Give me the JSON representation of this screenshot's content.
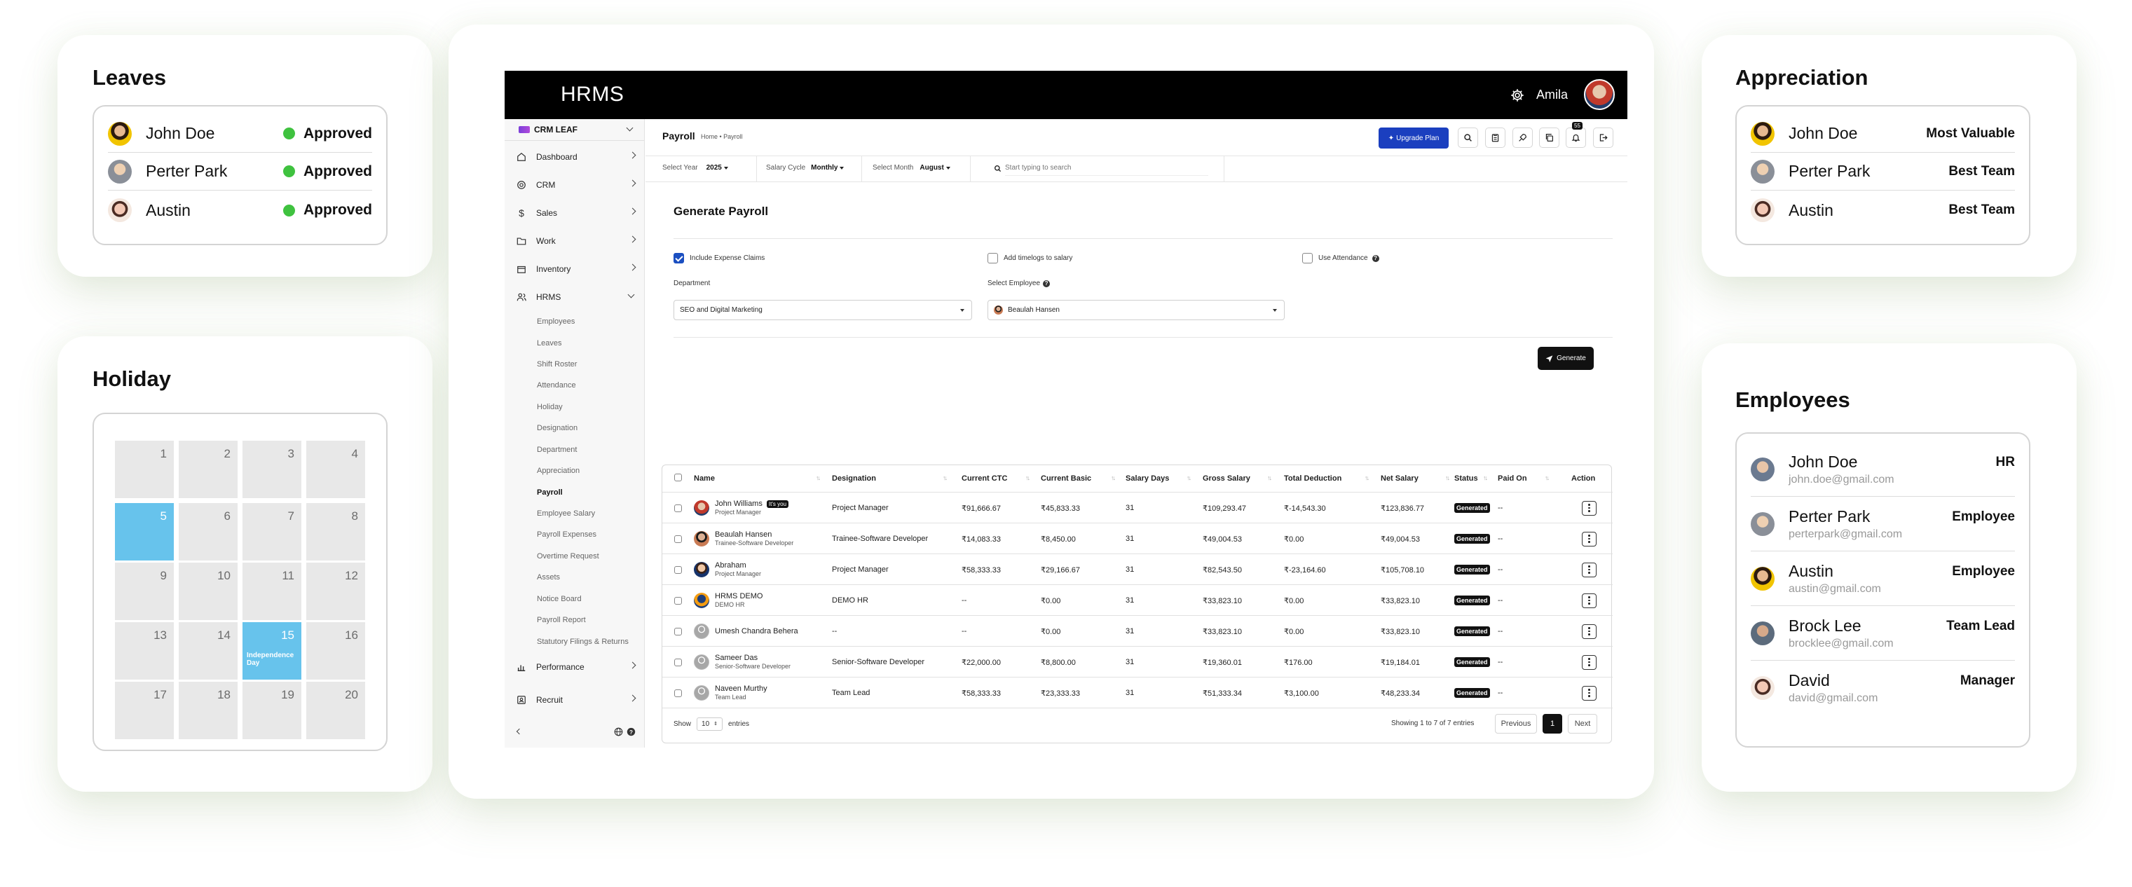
{
  "leaves": {
    "title": "Leaves",
    "items": [
      {
        "name": "John Doe",
        "status": "Approved"
      },
      {
        "name": "Perter Park",
        "status": "Approved"
      },
      {
        "name": "Austin",
        "status": "Approved"
      }
    ]
  },
  "holiday": {
    "title": "Holiday",
    "days": [
      "1",
      "2",
      "3",
      "4",
      "5",
      "6",
      "7",
      "8",
      "9",
      "10",
      "11",
      "12",
      "13",
      "14",
      "15",
      "16",
      "17",
      "18",
      "19",
      "20"
    ],
    "event_label": "Independence Day"
  },
  "appreciation": {
    "title": "Appreciation",
    "items": [
      {
        "name": "John Doe",
        "award": "Most Valuable"
      },
      {
        "name": "Perter Park",
        "award": "Best Team"
      },
      {
        "name": "Austin",
        "award": "Best Team"
      }
    ]
  },
  "employees": {
    "title": "Employees",
    "items": [
      {
        "name": "John Doe",
        "email": "john.doe@gmail.com",
        "role": "HR"
      },
      {
        "name": "Perter Park",
        "email": "perterpark@gmail.com",
        "role": "Employee"
      },
      {
        "name": "Austin",
        "email": "austin@gmail.com",
        "role": "Employee"
      },
      {
        "name": "Brock Lee",
        "email": "brocklee@gmail.com",
        "role": "Team Lead"
      },
      {
        "name": "David",
        "email": "david@gmail.com",
        "role": "Manager"
      }
    ]
  },
  "app": {
    "brand": "HRMS",
    "user_name": "Amila",
    "notif_count": "55",
    "workspace": "CRM LEAF",
    "nav": [
      {
        "label": "Dashboard"
      },
      {
        "label": "CRM"
      },
      {
        "label": "Sales"
      },
      {
        "label": "Work"
      },
      {
        "label": "Inventory"
      },
      {
        "label": "HRMS"
      }
    ],
    "hrms_sub": [
      "Employees",
      "Leaves",
      "Shift Roster",
      "Attendance",
      "Holiday",
      "Designation",
      "Department",
      "Appreciation",
      "Payroll",
      "Employee Salary",
      "Payroll Expenses",
      "Overtime Request",
      "Assets",
      "Notice Board",
      "Payroll Report",
      "Statutory Filings & Returns"
    ],
    "nav_bottom": [
      {
        "label": "Performance"
      },
      {
        "label": "Recruit"
      }
    ],
    "page_title": "Payroll",
    "breadcrumb": "Home • Payroll",
    "upgrade_label": "Upgrade Plan",
    "filters": {
      "year_label": "Select Year",
      "year_value": "2025",
      "cycle_label": "Salary Cycle",
      "cycle_value": "Monthly",
      "month_label": "Select Month",
      "month_value": "August",
      "search_placeholder": "Start typing to search"
    },
    "generate": {
      "title": "Generate Payroll",
      "include_expense": "Include Expense Claims",
      "add_timelogs": "Add timelogs to salary",
      "use_attendance": "Use Attendance",
      "department_label": "Department",
      "department_value": "SEO and Digital Marketing",
      "employee_label": "Select Employee",
      "employee_value": "Beaulah Hansen",
      "button": "Generate"
    },
    "table": {
      "headers": [
        "Name",
        "Designation",
        "Current CTC",
        "Current Basic",
        "Salary Days",
        "Gross Salary",
        "Total Deduction",
        "Net Salary",
        "Status",
        "Paid On",
        "Action"
      ],
      "you_badge": "It's you",
      "rows": [
        {
          "name": "John Williams",
          "sub": "Project Manager",
          "designation": "Project Manager",
          "ctc": "₹91,666.67",
          "basic": "₹45,833.33",
          "days": "31",
          "gross": "₹109,293.47",
          "deduction": "₹-14,543.30",
          "net": "₹123,836.77",
          "status": "Generated",
          "paid": "--"
        },
        {
          "name": "Beaulah Hansen",
          "sub": "Trainee-Software Developer",
          "designation": "Trainee-Software Developer",
          "ctc": "₹14,083.33",
          "basic": "₹8,450.00",
          "days": "31",
          "gross": "₹49,004.53",
          "deduction": "₹0.00",
          "net": "₹49,004.53",
          "status": "Generated",
          "paid": "--"
        },
        {
          "name": "Abraham",
          "sub": "Project Manager",
          "designation": "Project Manager",
          "ctc": "₹58,333.33",
          "basic": "₹29,166.67",
          "days": "31",
          "gross": "₹82,543.50",
          "deduction": "₹-23,164.60",
          "net": "₹105,708.10",
          "status": "Generated",
          "paid": "--"
        },
        {
          "name": "HRMS DEMO",
          "sub": "DEMO HR",
          "designation": "DEMO HR",
          "ctc": "--",
          "basic": "₹0.00",
          "days": "31",
          "gross": "₹33,823.10",
          "deduction": "₹0.00",
          "net": "₹33,823.10",
          "status": "Generated",
          "paid": "--"
        },
        {
          "name": "Umesh Chandra Behera",
          "sub": "",
          "designation": "--",
          "ctc": "--",
          "basic": "₹0.00",
          "days": "31",
          "gross": "₹33,823.10",
          "deduction": "₹0.00",
          "net": "₹33,823.10",
          "status": "Generated",
          "paid": "--"
        },
        {
          "name": "Sameer Das",
          "sub": "Senior-Software Developer",
          "designation": "Senior-Software Developer",
          "ctc": "₹22,000.00",
          "basic": "₹8,800.00",
          "days": "31",
          "gross": "₹19,360.01",
          "deduction": "₹176.00",
          "net": "₹19,184.01",
          "status": "Generated",
          "paid": "--"
        },
        {
          "name": "Naveen Murthy",
          "sub": "Team Lead",
          "designation": "Team Lead",
          "ctc": "₹58,333.33",
          "basic": "₹23,333.33",
          "days": "31",
          "gross": "₹51,333.34",
          "deduction": "₹3,100.00",
          "net": "₹48,233.34",
          "status": "Generated",
          "paid": "--"
        }
      ]
    },
    "footer": {
      "show_label": "Show",
      "page_size": "10",
      "entries_label": "entries",
      "showing_text": "Showing 1 to 7 of 7 entries",
      "prev": "Previous",
      "page": "1",
      "next": "Next"
    }
  }
}
